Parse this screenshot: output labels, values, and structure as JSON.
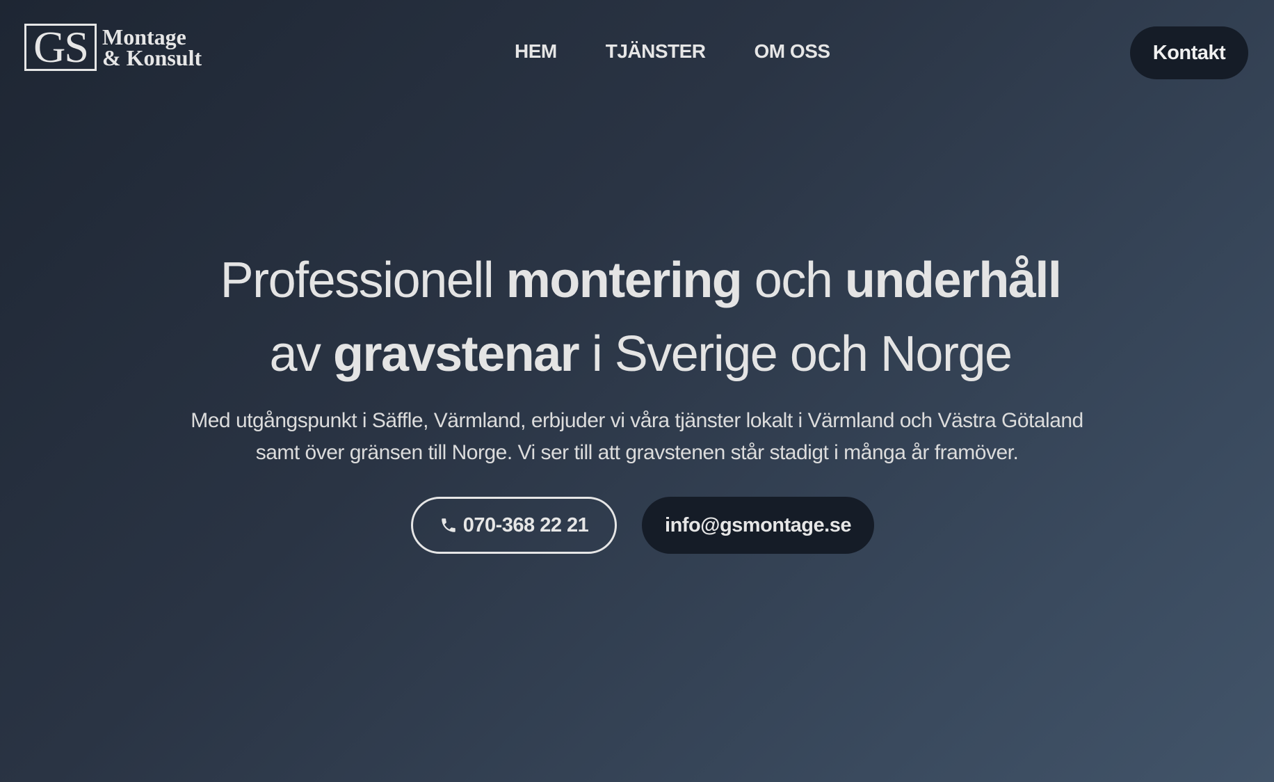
{
  "brand": {
    "mark": "GS",
    "line1": "Montage",
    "line2": "& Konsult"
  },
  "nav": {
    "items": [
      {
        "label": "HEM"
      },
      {
        "label": "TJÄNSTER"
      },
      {
        "label": "OM OSS"
      }
    ],
    "contact_label": "Kontakt"
  },
  "hero": {
    "headline": {
      "l1_a": "Professionell ",
      "l1_b": "montering",
      "l1_c": " och ",
      "l1_d": "underhåll",
      "l2_a": "av ",
      "l2_b": "gravstenar",
      "l2_c": " i Sverige och Norge"
    },
    "subtext_line1": "Med utgångspunkt i Säffle, Värmland, erbjuder vi våra tjänster lokalt i Värmland och Västra Götaland",
    "subtext_line2": "samt över gränsen till Norge. Vi ser till att gravstenen står stadigt i många år framöver.",
    "phone_label": "070-368 22 21",
    "phone_icon": "phone-icon",
    "email_label": "info@gsmontage.se"
  },
  "colors": {
    "background_start": "#1e2633",
    "background_end": "#425469",
    "button_dark": "#151c27",
    "text": "#e6e6e6"
  }
}
